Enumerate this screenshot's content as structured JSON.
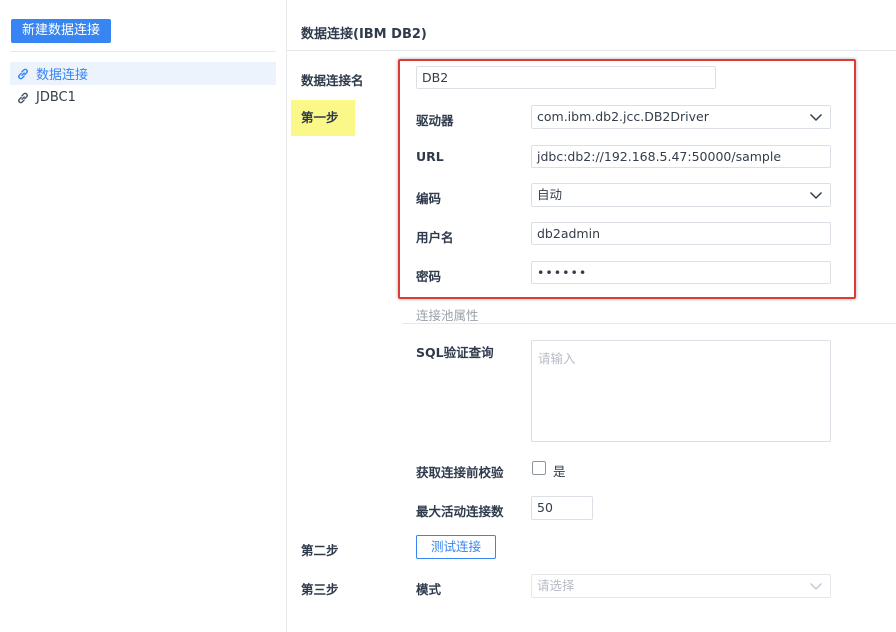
{
  "left_panel": {
    "new_connection_button": "新建数据连接",
    "tree": [
      {
        "label": "数据连接",
        "icon": "link-icon",
        "active": true
      },
      {
        "label": "JDBC1",
        "icon": "link-icon",
        "active": false
      }
    ]
  },
  "header": {
    "title": "数据连接(IBM DB2)"
  },
  "form": {
    "connection_name_label": "数据连接名",
    "connection_name_value": "DB2",
    "step1_label": "第一步",
    "driver_label": "驱动器",
    "driver_value": "com.ibm.db2.jcc.DB2Driver",
    "url_label": "URL",
    "url_value": "jdbc:db2://192.168.5.47:50000/sample",
    "encoding_label": "编码",
    "encoding_value": "自动",
    "username_label": "用户名",
    "username_value": "db2admin",
    "password_label": "密码",
    "password_value": "••••••",
    "pool_section_label": "连接池属性",
    "sql_validate_label": "SQL验证查询",
    "sql_validate_placeholder": "请输入",
    "validate_before_label": "获取连接前校验",
    "validate_before_checkbox_label": "是",
    "validate_before_checked": false,
    "max_active_label": "最大活动连接数",
    "max_active_value": "50",
    "step2_label": "第二步",
    "test_connection_button": "测试连接",
    "step3_label": "第三步",
    "schema_label": "模式",
    "schema_placeholder": "请选择"
  },
  "colors": {
    "accent": "#3685f2",
    "highlight": "#fbf88a",
    "annotation_box": "#dd3b35"
  }
}
